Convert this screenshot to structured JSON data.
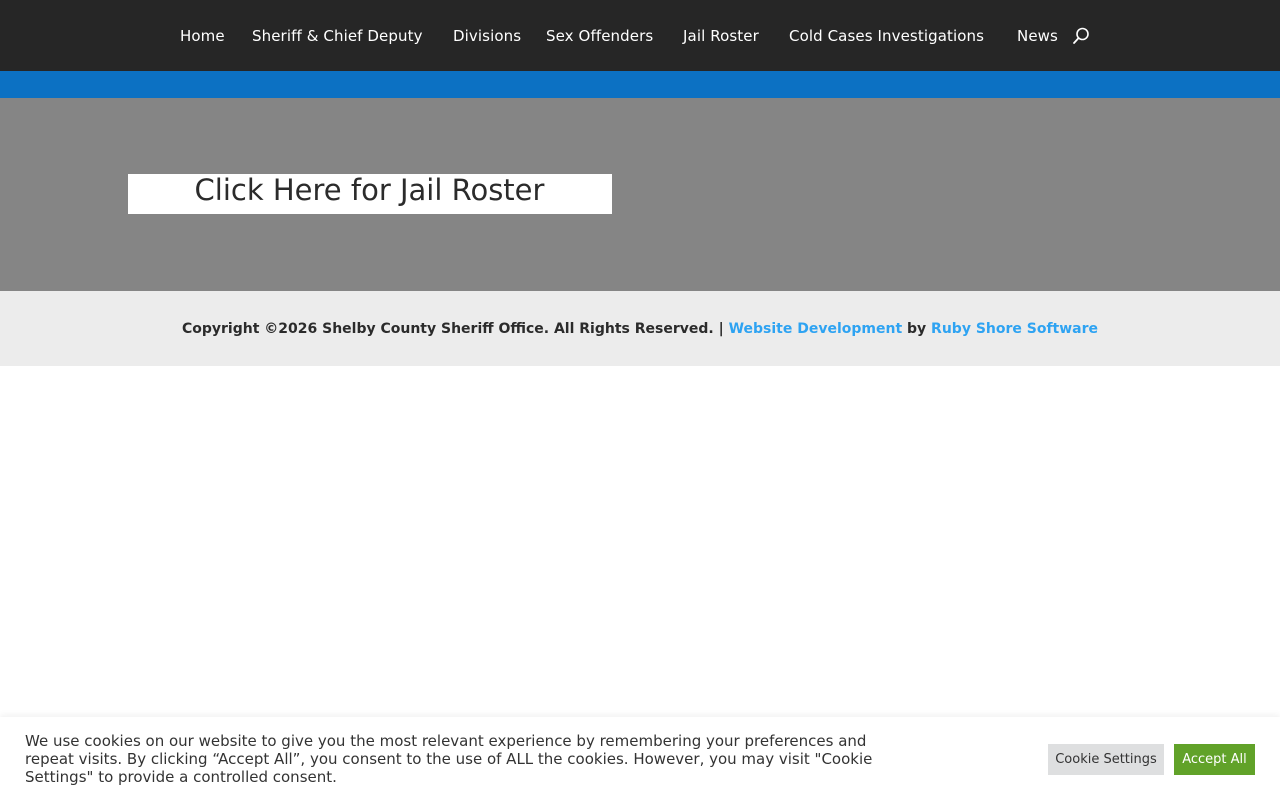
{
  "nav": {
    "items": [
      {
        "label": "Home"
      },
      {
        "label": "Sheriff & Chief Deputy"
      },
      {
        "label": "Divisions"
      },
      {
        "label": "Sex Offenders"
      },
      {
        "label": "Jail Roster"
      },
      {
        "label": "Cold Cases Investigations"
      },
      {
        "label": "News"
      }
    ],
    "search_icon": "search-icon"
  },
  "hero": {
    "button_label": "Click Here for Jail Roster"
  },
  "footer": {
    "copyright": "Copyright ©2026 Shelby County Sheriff Office. All Rights Reserved. | ",
    "link1": "Website Development",
    "by": " by ",
    "link2": "Ruby Shore Software"
  },
  "cookie": {
    "message": "We use cookies on our website to give you the most relevant experience by remembering your preferences and repeat visits. By clicking “Accept All”, you consent to the use of ALL the cookies. However, you may visit \"Cookie Settings\" to provide a controlled consent.",
    "settings_label": "Cookie Settings",
    "accept_label": "Accept All"
  },
  "colors": {
    "nav_bg": "#262626",
    "accent_blue": "#0c71c3",
    "hero_bg": "#858585",
    "footer_bg": "#ececec",
    "link": "#2ea3f2",
    "accept_green": "#61a229"
  }
}
